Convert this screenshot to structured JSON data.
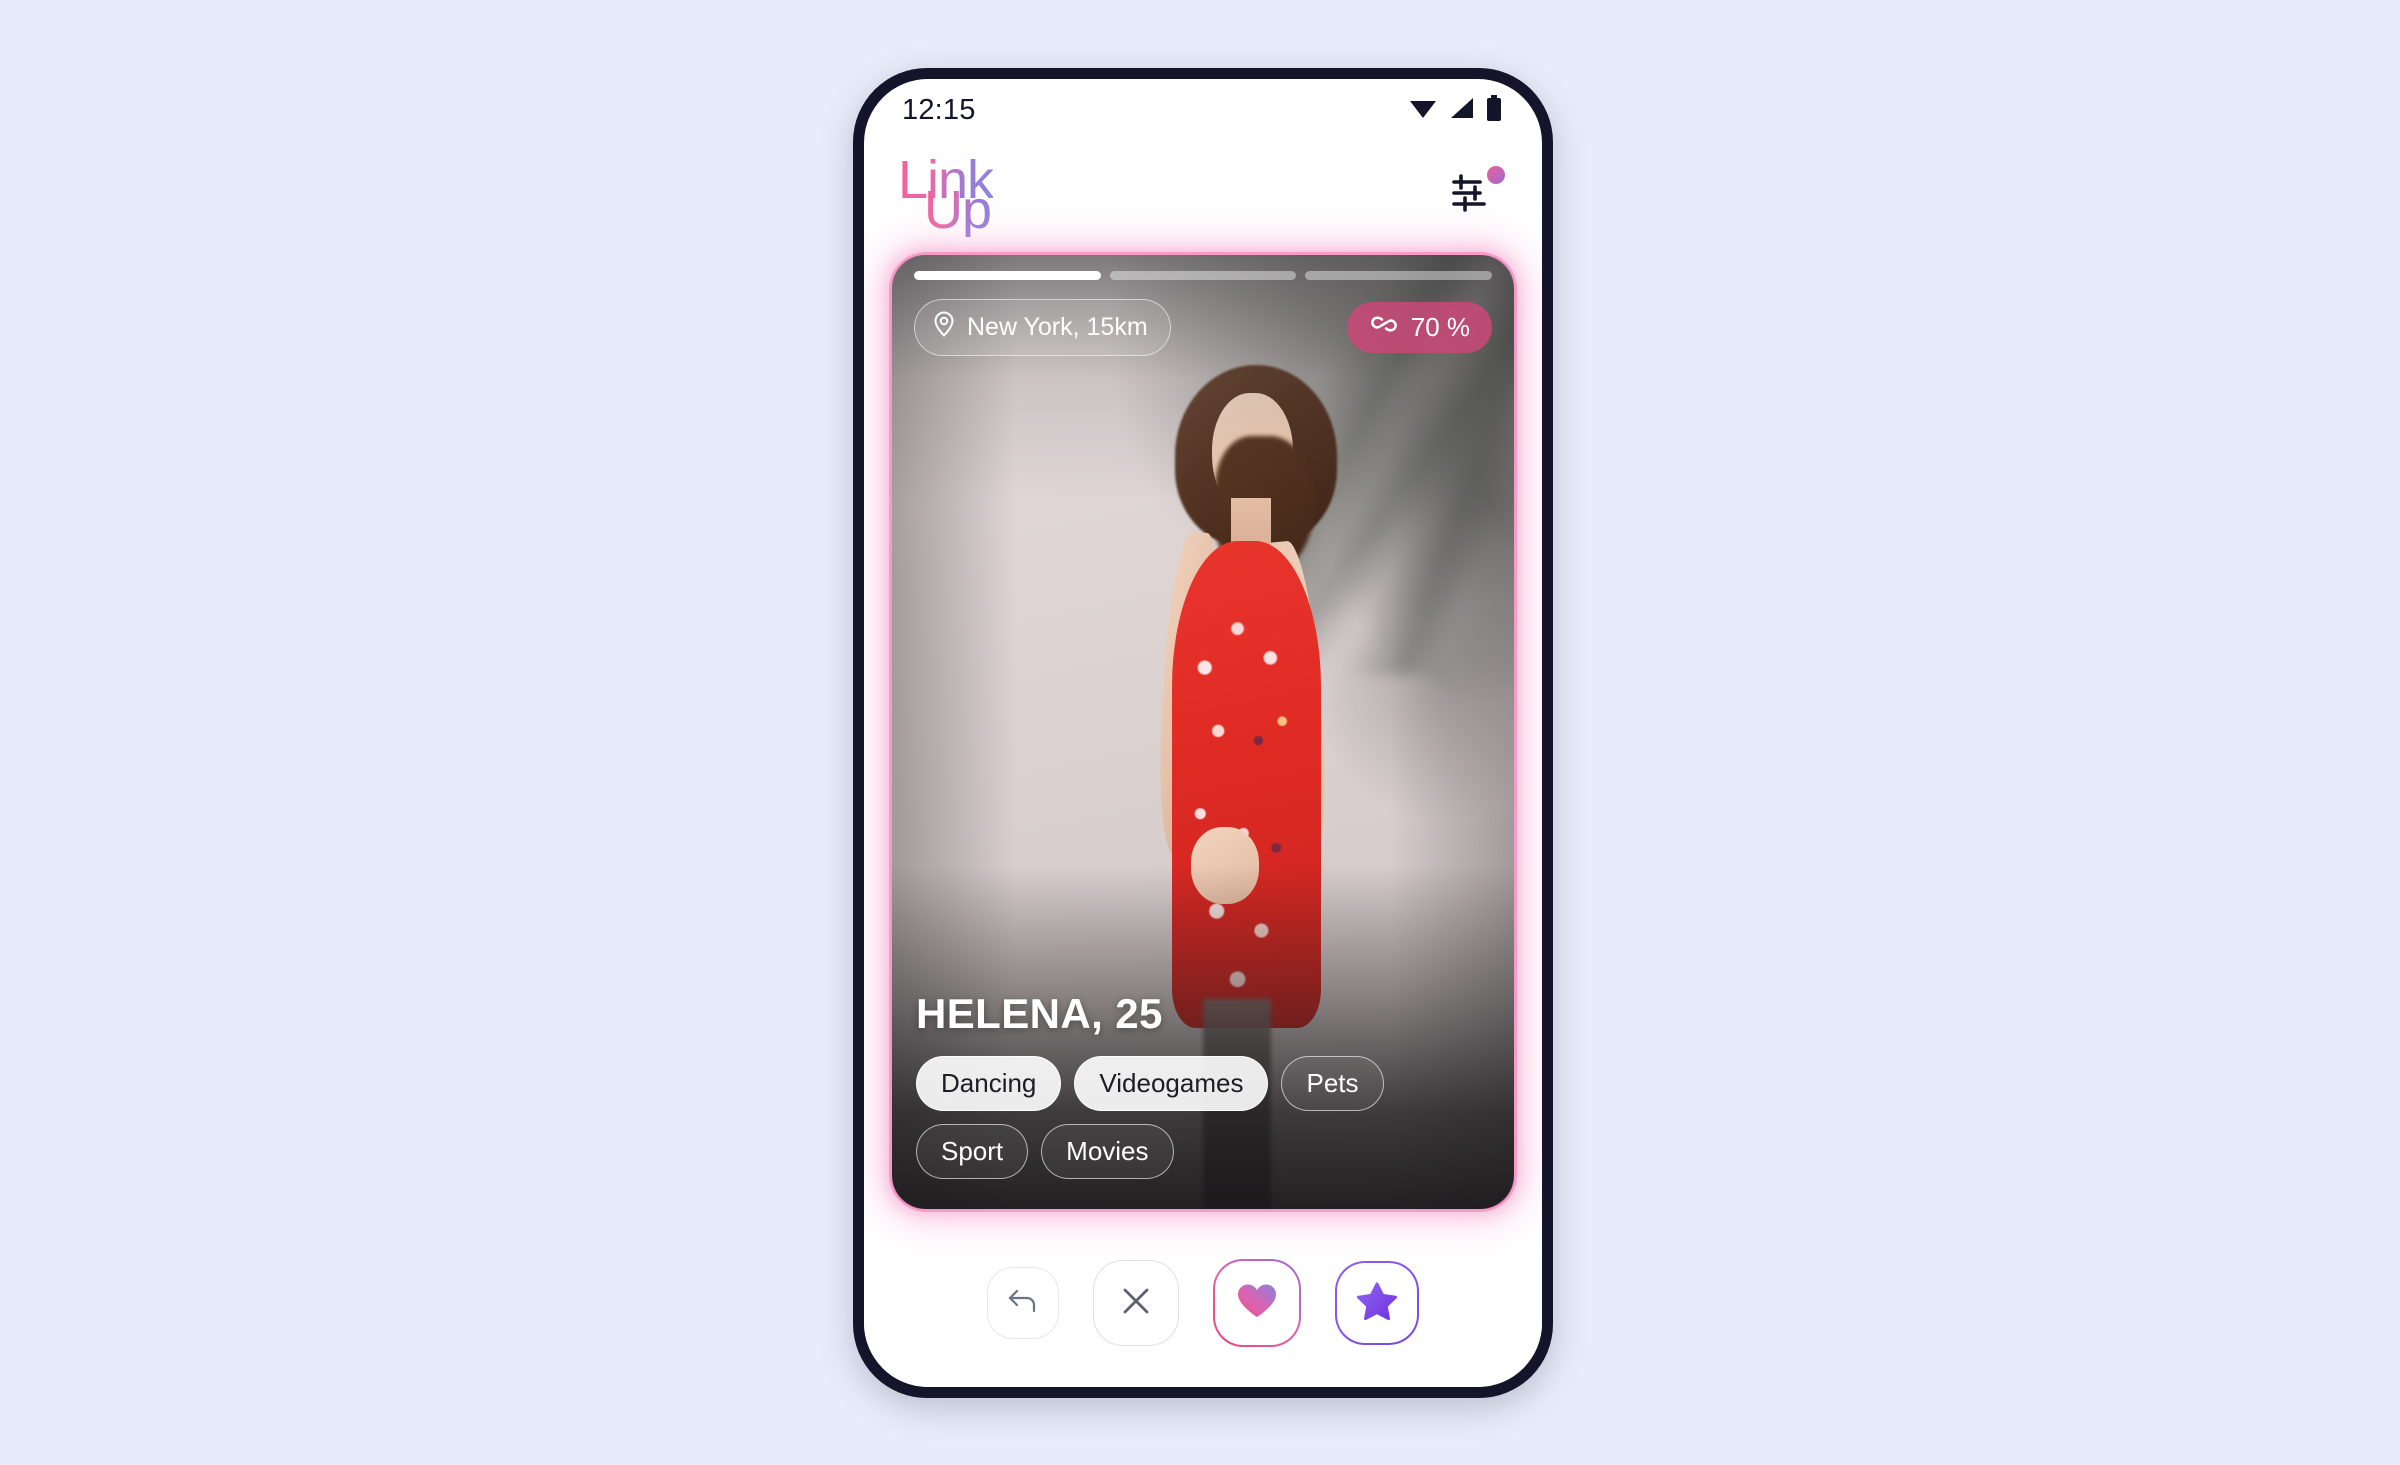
{
  "statusbar": {
    "time": "12:15",
    "icons": [
      "wifi-icon",
      "signal-icon",
      "battery-icon"
    ]
  },
  "header": {
    "logo_line1": "Link",
    "logo_line2": "Up",
    "logo_gradient_from": "#F2609A",
    "logo_gradient_to": "#8B86E0",
    "filter_icon": "sliders-icon",
    "filter_badge": true,
    "filter_badge_color": "#D06AB8"
  },
  "card": {
    "photo_count": 3,
    "active_photo_index": 1,
    "glow_color": "#F48CC3",
    "location": {
      "icon": "map-pin-icon",
      "label": "New York, 15km"
    },
    "match": {
      "icon": "link-chain-icon",
      "label": "70 %",
      "value": 70,
      "color": "#C94876"
    },
    "profile": {
      "name": "HELENA, 25",
      "display_name": "HELENA",
      "age": 25,
      "tags": [
        {
          "label": "Dancing",
          "shared": true
        },
        {
          "label": "Videogames",
          "shared": true
        },
        {
          "label": "Pets",
          "shared": false
        },
        {
          "label": "Sport",
          "shared": false
        },
        {
          "label": "Movies",
          "shared": false
        }
      ]
    }
  },
  "actions": [
    {
      "name": "undo-button",
      "icon": "undo-arrow-icon",
      "color": "#6b7280"
    },
    {
      "name": "nope-button",
      "icon": "close-x-icon",
      "color": "#5c6270"
    },
    {
      "name": "like-button",
      "icon": "heart-icon",
      "color": "#E5579E"
    },
    {
      "name": "super-like-button",
      "icon": "star-icon",
      "color": "#7B45E8"
    }
  ],
  "theme": {
    "page_background": "#E8ECFA",
    "phone_frame": "#14152A",
    "screen_background": "#FFFFFF"
  }
}
